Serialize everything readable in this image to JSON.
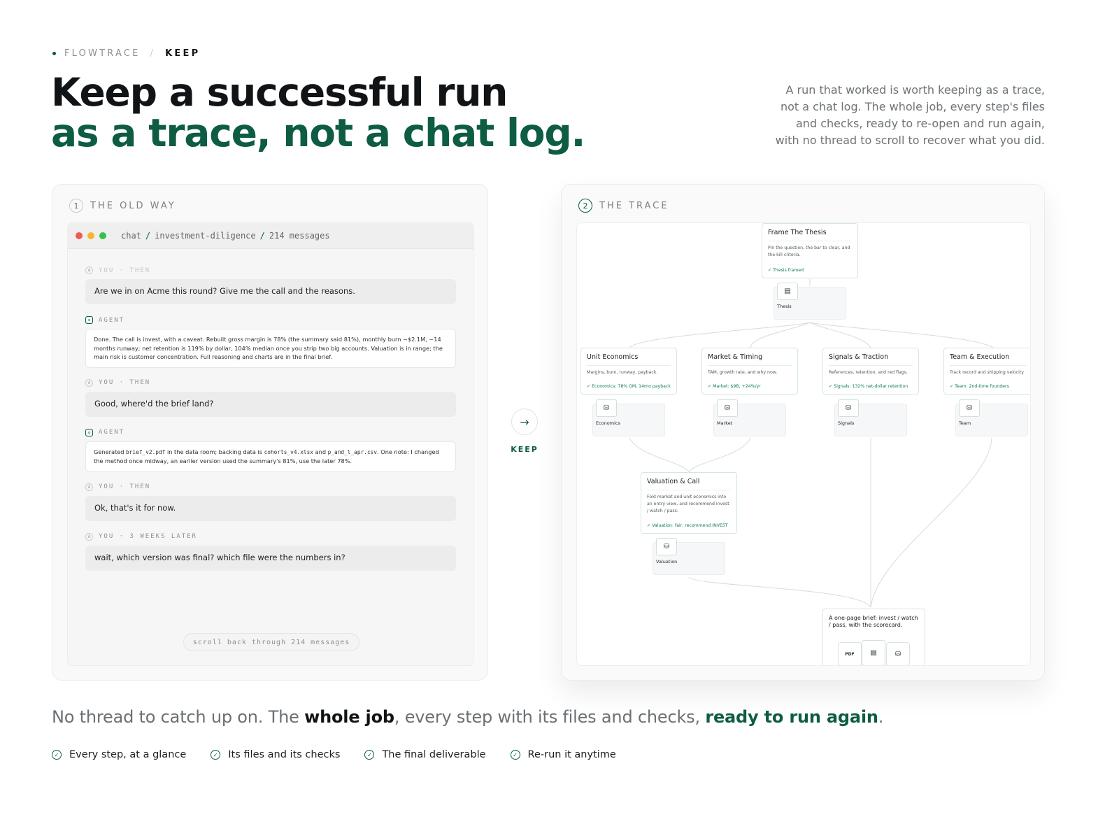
{
  "header": {
    "brand": "FLOWTRACE",
    "page": "KEEP",
    "title_line1": "Keep a successful run",
    "title_line2": "as a trace, not a chat log.",
    "lede": "A run that worked is worth keeping as a trace, not a chat log. The whole job, every step's files and checks, ready to re-open and run again, with no thread to scroll to recover what you did."
  },
  "old_way": {
    "num": "1",
    "label": "THE OLD WAY",
    "chat_path": [
      "chat",
      "investment-diligence",
      "214 messages"
    ],
    "messages": [
      {
        "who": "YOU · THEN",
        "text": "Are we in on Acme this round? Give me the call and the reasons."
      },
      {
        "who": "AGENT",
        "text": "Done. The call is invest, with a caveat. Rebuilt gross margin is 78% (the summary said 81%), monthly burn ~$2.1M, ~14 months runway; net retention is 119% by dollar, 104% median once you strip two big accounts. Valuation is in range; the main risk is customer concentration. Full reasoning and charts are in the final brief."
      },
      {
        "who": "YOU · THEN",
        "text": "Good, where'd the brief land?"
      },
      {
        "who": "AGENT",
        "text_parts": [
          "Generated ",
          "brief_v2.pdf",
          " in the data room; backing data is ",
          "cohorts_v4.xlsx",
          " and ",
          "p_and_l_apr.csv",
          ". One note: I changed the method once midway, an earlier version used the summary's 81%, use the later 78%."
        ]
      },
      {
        "who": "YOU · THEN",
        "text": "Ok, that's it for now."
      },
      {
        "who": "YOU · 3 WEEKS LATER",
        "text": "wait, which version was final? which file were the numbers in?"
      }
    ],
    "scroll_pill": "scroll back through 214 messages"
  },
  "keep": {
    "label": "KEEP"
  },
  "trace": {
    "num": "2",
    "label": "THE TRACE",
    "nodes": {
      "frame": {
        "title": "Frame The Thesis",
        "desc": "Pin the question, the bar to clear, and the kill criteria.",
        "check": "✓ Thesis framed",
        "file": "Thesis"
      },
      "unit": {
        "title": "Unit Economics",
        "desc": "Margins, burn, runway, payback.",
        "check": "✓ Economics: 78% GM, 14mo payback",
        "file": "Economics"
      },
      "market": {
        "title": "Market & Timing",
        "desc": "TAM, growth rate, and why now.",
        "check": "✓ Market: $9B, +24%/yr",
        "file": "Market"
      },
      "signals": {
        "title": "Signals & Traction",
        "desc": "References, retention, and red flags.",
        "check": "✓ Signals: 132% net-dollar retention",
        "file": "Signals"
      },
      "team": {
        "title": "Team & Execution",
        "desc": "Track record and shipping velocity.",
        "check": "✓ Team: 2nd-time founders",
        "file": "Team"
      },
      "valuation": {
        "title": "Valuation & Call",
        "desc": "Fold market and unit economics into an entry view, and recommend invest / watch / pass.",
        "check": "✓ Valuation: fair, recommend INVEST",
        "file": "Valuation"
      }
    },
    "deliverable": {
      "text": "A one-page brief: invest / watch / pass, with the scorecard.",
      "pdf_tag": "PDF"
    }
  },
  "footer": {
    "t1": "No thread to catch up on. The ",
    "t2": "whole job",
    "t3": ", every step with its files and checks, ",
    "t4": "ready to run again",
    "t5": ".",
    "features": [
      "Every step, at a glance",
      "Its files and its checks",
      "The final deliverable",
      "Re-run it anytime"
    ]
  },
  "colors": {
    "accent": "#0d5c43",
    "traffic": [
      "#ef5b52",
      "#f5b82e",
      "#35c24a"
    ]
  },
  "icons": {
    "doc": "document-icon",
    "db": "database-icon",
    "arrow": "arrow-right-icon",
    "check": "check-circle-icon"
  }
}
